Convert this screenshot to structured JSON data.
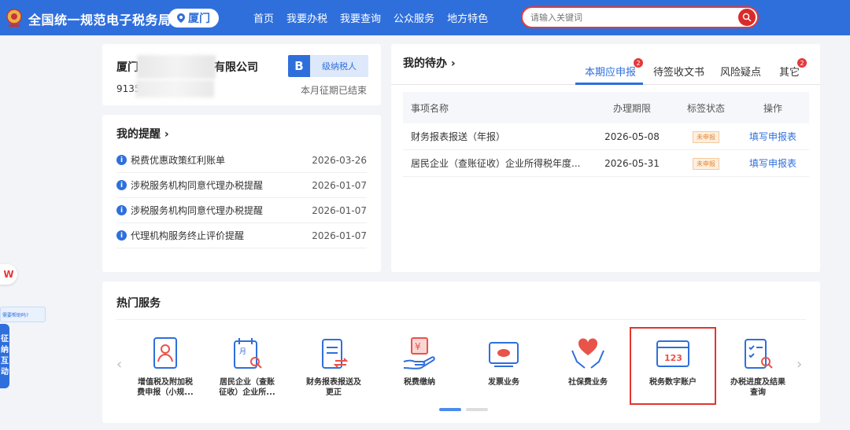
{
  "header": {
    "site_title": "全国统一规范电子税务局",
    "region": "厦门",
    "nav": [
      "首页",
      "我要办税",
      "我要查询",
      "公众服务",
      "地方特色"
    ],
    "search_placeholder": "请输入关键词"
  },
  "company": {
    "name_visible_start": "厦门",
    "name_visible_end": "有限公司",
    "tax_id_visible": "9135",
    "taxpayer_letter": "B",
    "taxpayer_level": "级纳税人",
    "period_status": "本月征期已结束"
  },
  "reminders": {
    "title": "我的提醒",
    "items": [
      {
        "text": "税费优惠政策红利账单",
        "date": "2026-03-26"
      },
      {
        "text": "涉税服务机构同意代理办税提醒",
        "date": "2026-01-07"
      },
      {
        "text": "涉税服务机构同意代理办税提醒",
        "date": "2026-01-07"
      },
      {
        "text": "代理机构服务终止评价提醒",
        "date": "2026-01-07"
      }
    ]
  },
  "todo": {
    "title": "我的待办",
    "tabs": [
      {
        "label": "本期应申报",
        "badge": "2"
      },
      {
        "label": "待签收文书",
        "badge": ""
      },
      {
        "label": "风险疑点",
        "badge": ""
      },
      {
        "label": "其它",
        "badge": "2"
      }
    ],
    "columns": [
      "事项名称",
      "办理期限",
      "标签状态",
      "操作"
    ],
    "rows": [
      {
        "name": "财务报表报送（年报）",
        "deadline": "2026-05-08",
        "status": "未申报",
        "action": "填写申报表"
      },
      {
        "name": "居民企业（查账征收）企业所得税年度...",
        "deadline": "2026-05-31",
        "status": "未申报",
        "action": "填写申报表"
      }
    ]
  },
  "hot_services": {
    "title": "热门服务",
    "items": [
      {
        "line1": "增值税及附加税",
        "line2": "费申报（小规..."
      },
      {
        "line1": "居民企业（查账",
        "line2": "征收）企业所..."
      },
      {
        "line1": "财务报表报送及",
        "line2": "更正"
      },
      {
        "line1": "税费缴纳",
        "line2": ""
      },
      {
        "line1": "发票业务",
        "line2": ""
      },
      {
        "line1": "社保费业务",
        "line2": ""
      },
      {
        "line1": "税务数字账户",
        "line2": ""
      },
      {
        "line1": "办税进度及结果",
        "line2": "查询"
      }
    ],
    "account_icon_text": "123"
  },
  "side": {
    "help_bubble": "需要帮助吗?",
    "help_tab": [
      "征",
      "纳",
      "互",
      "动"
    ],
    "wps": "W"
  },
  "colors": {
    "primary": "#2f6fdc",
    "danger": "#e43a3a",
    "warning": "#e8862a"
  }
}
